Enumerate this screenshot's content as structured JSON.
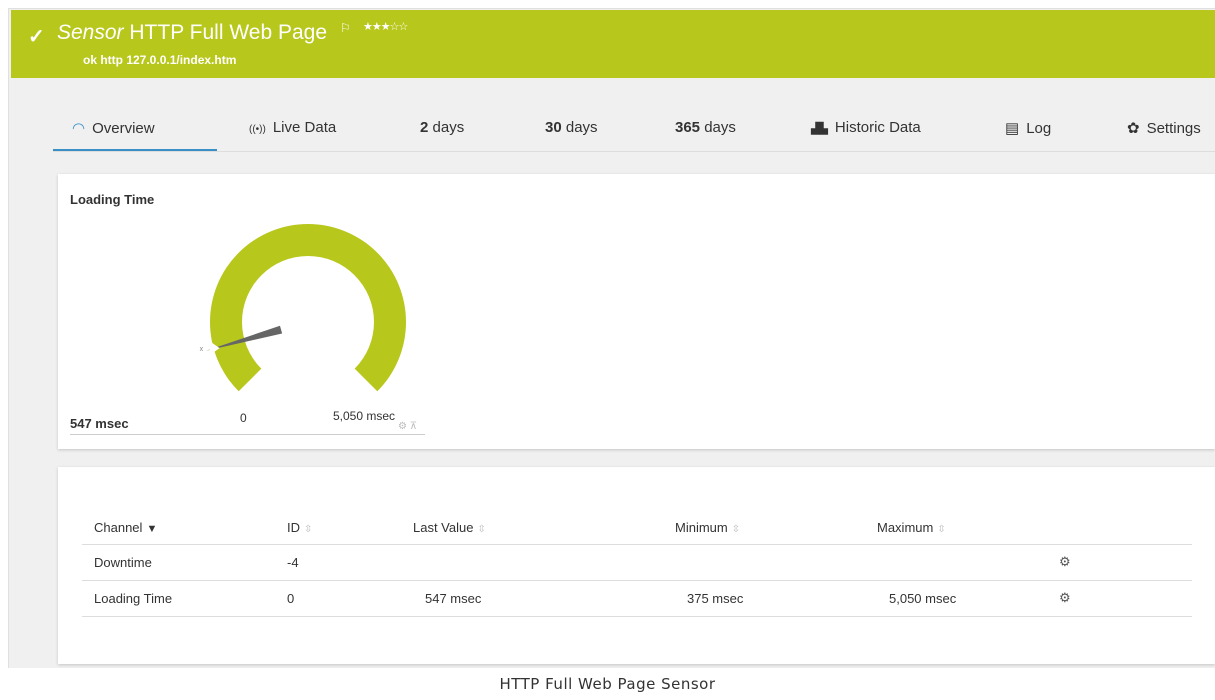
{
  "header": {
    "title_kind": "Sensor",
    "title_name": "HTTP Full Web Page",
    "flag_icon": "flag-icon",
    "stars": "★★★☆☆",
    "status_line": "ok http 127.0.0.1/index.htm",
    "color": "#b8c71c"
  },
  "tabs": [
    {
      "icon": "◠",
      "label": "Overview"
    },
    {
      "icon": "((•))",
      "label": "Live Data"
    },
    {
      "num": "2",
      "label": "days"
    },
    {
      "num": "30",
      "label": "days"
    },
    {
      "num": "365",
      "label": "days"
    },
    {
      "icon": "▟▙",
      "label": "Historic Data"
    },
    {
      "icon": "▤",
      "label": "Log"
    },
    {
      "icon": "✿",
      "label": "Settings"
    }
  ],
  "gauge": {
    "title": "Loading Time",
    "value_text": "547 msec",
    "min_label": "0",
    "max_label": "5,050 msec",
    "min": 0,
    "max": 5050,
    "value": 547,
    "color": "#b8c71c"
  },
  "table": {
    "headers": [
      "Channel",
      "ID",
      "Last Value",
      "Minimum",
      "Maximum"
    ],
    "rows": [
      {
        "channel": "Downtime",
        "id": "-4",
        "last": "",
        "min": "",
        "max": ""
      },
      {
        "channel": "Loading Time",
        "id": "0",
        "last": "547 msec",
        "min": "375 msec",
        "max": "5,050 msec"
      }
    ]
  },
  "caption": "HTTP Full Web Page Sensor"
}
